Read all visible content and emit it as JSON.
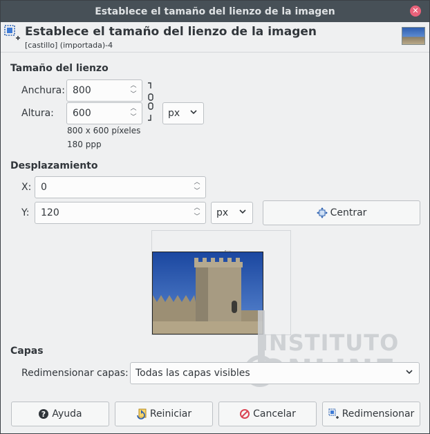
{
  "window": {
    "title": "Establece el tamaño del lienzo de la imagen"
  },
  "header": {
    "title": "Establece el tamaño del lienzo de la imagen",
    "subtitle": "[castillo] (importada)-4"
  },
  "canvas_size": {
    "section_title": "Tamaño del lienzo",
    "width_label": "Anchura:",
    "width_value": "800",
    "height_label": "Altura:",
    "height_value": "600",
    "unit": "px",
    "info_pixels": "800 x 600 píxeles",
    "info_ppp": "180 ppp"
  },
  "offset": {
    "section_title": "Desplazamiento",
    "x_label": "X:",
    "x_value": "0",
    "y_label": "Y:",
    "y_value": "120",
    "unit": "px",
    "center_label": "Centrar"
  },
  "layers": {
    "section_title": "Capas",
    "resize_label": "Redimensionar capas:",
    "resize_value": "Todas las capas visibles"
  },
  "buttons": {
    "help": "Ayuda",
    "reset": "Reiniciar",
    "cancel": "Cancelar",
    "resize": "Redimensionar"
  },
  "watermark": {
    "line1": "INSTITUTO",
    "line2": "ONLINE"
  },
  "colors": {
    "titlebar": "#475057",
    "window_bg": "#eff0f1",
    "close": "#e8627a",
    "cancel_icon": "#da4453"
  }
}
